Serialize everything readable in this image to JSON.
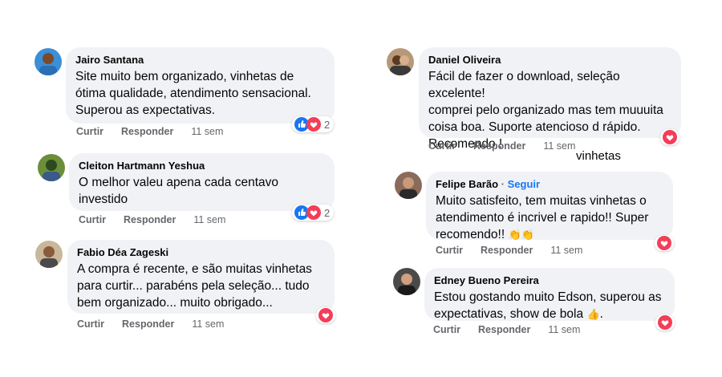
{
  "comments": [
    {
      "author": "Jairo Santana",
      "text": "Site muito bem organizado, vinhetas de\nótima qualidade, atendimento sensacional.\nSuperou as expectativas.",
      "reaction_count": "2",
      "reactions": [
        "like-icon",
        "heart-icon"
      ]
    },
    {
      "author": "Cleiton Hartmann Yeshua",
      "text": "O melhor valeu apena cada centavo\ninvestido",
      "reaction_count": "2",
      "reactions": [
        "like-icon",
        "heart-icon"
      ]
    },
    {
      "author": "Fabio Déa Zageski",
      "text": "A compra é recente, e são muitas vinhetas\npara curtir... parabéns pela seleção... tudo\nbem organizado... muito obrigado...",
      "reactions": [
        "heart-icon"
      ]
    },
    {
      "author": "Daniel Oliveira",
      "text": "Fácil de fazer o download, seleção excelente!\ncomprei pelo organizado mas tem muuuita\ncoisa boa. Suporte atencioso d rápido.\nRecomendo !",
      "reactions": [
        "heart-icon"
      ]
    },
    {
      "author": "Felipe Barão",
      "follow_label": "Seguir",
      "text": "Muito satisfeito, tem muitas vinhetas o\natendimento é incrivel e rapido!! Super\nrecomendo!!",
      "reactions": [
        "heart-icon"
      ]
    },
    {
      "author": "Edney Bueno Pereira",
      "text": "Estou gostando muito Edson, superou as\nexpectativas, show de bola",
      "reactions": [
        "heart-icon"
      ]
    }
  ],
  "actions": {
    "like": "Curtir",
    "reply": "Responder",
    "time": "11 sem"
  },
  "stray_text": "vinhetas",
  "separator": "·",
  "colors": {
    "bubble": "#f0f2f5",
    "like_blue": "#1877f2",
    "heart_red": "#f33e58",
    "muted": "#65676b"
  },
  "emoji": [
    "clapping-hands-icon",
    "clapping-hands-icon",
    "thumbs-up-icon"
  ]
}
